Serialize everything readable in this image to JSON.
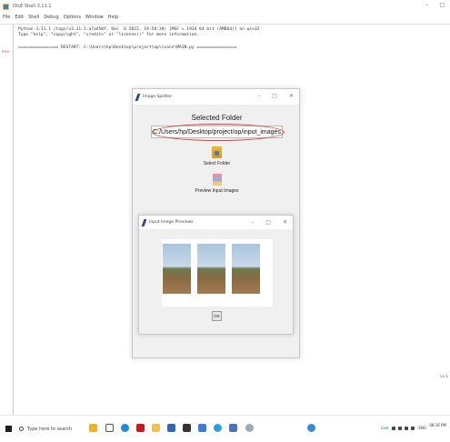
{
  "shell": {
    "title": "IDLE Shell 3.11.1",
    "menu": [
      "File",
      "Edit",
      "Shell",
      "Debug",
      "Options",
      "Window",
      "Help"
    ],
    "prompt": ">>>",
    "line1": "Python 3.11.1 (tags/v3.11.1:a7a450f, Dec  6 2022, 19:58:39) [MSC v.1934 64 bit (AMD64)] on win32",
    "line2": "Type \"help\", \"copyright\", \"credits\" or \"license()\" for more information.",
    "restart": "================ RESTART: C:\\Users\\hp\\Desktop\\project\\op\\icons\\MAIN.py ================",
    "status": "Ln 1"
  },
  "splitter": {
    "title": "Image Splitter",
    "selected_folder_label": "Selected Folder",
    "path": "C:/Users/hp/Desktop/project/op/input_images",
    "select_folder_label": "Select Folder",
    "preview_label": "Preview Input Images"
  },
  "preview": {
    "title": "Input Image Previews",
    "ok_label": "OK"
  },
  "taskbar": {
    "search_placeholder": "Type here to search",
    "weather": "Live",
    "language": "ENG",
    "time": "08:16 PM"
  },
  "colors": {
    "annotation_oval": "#d84040"
  }
}
